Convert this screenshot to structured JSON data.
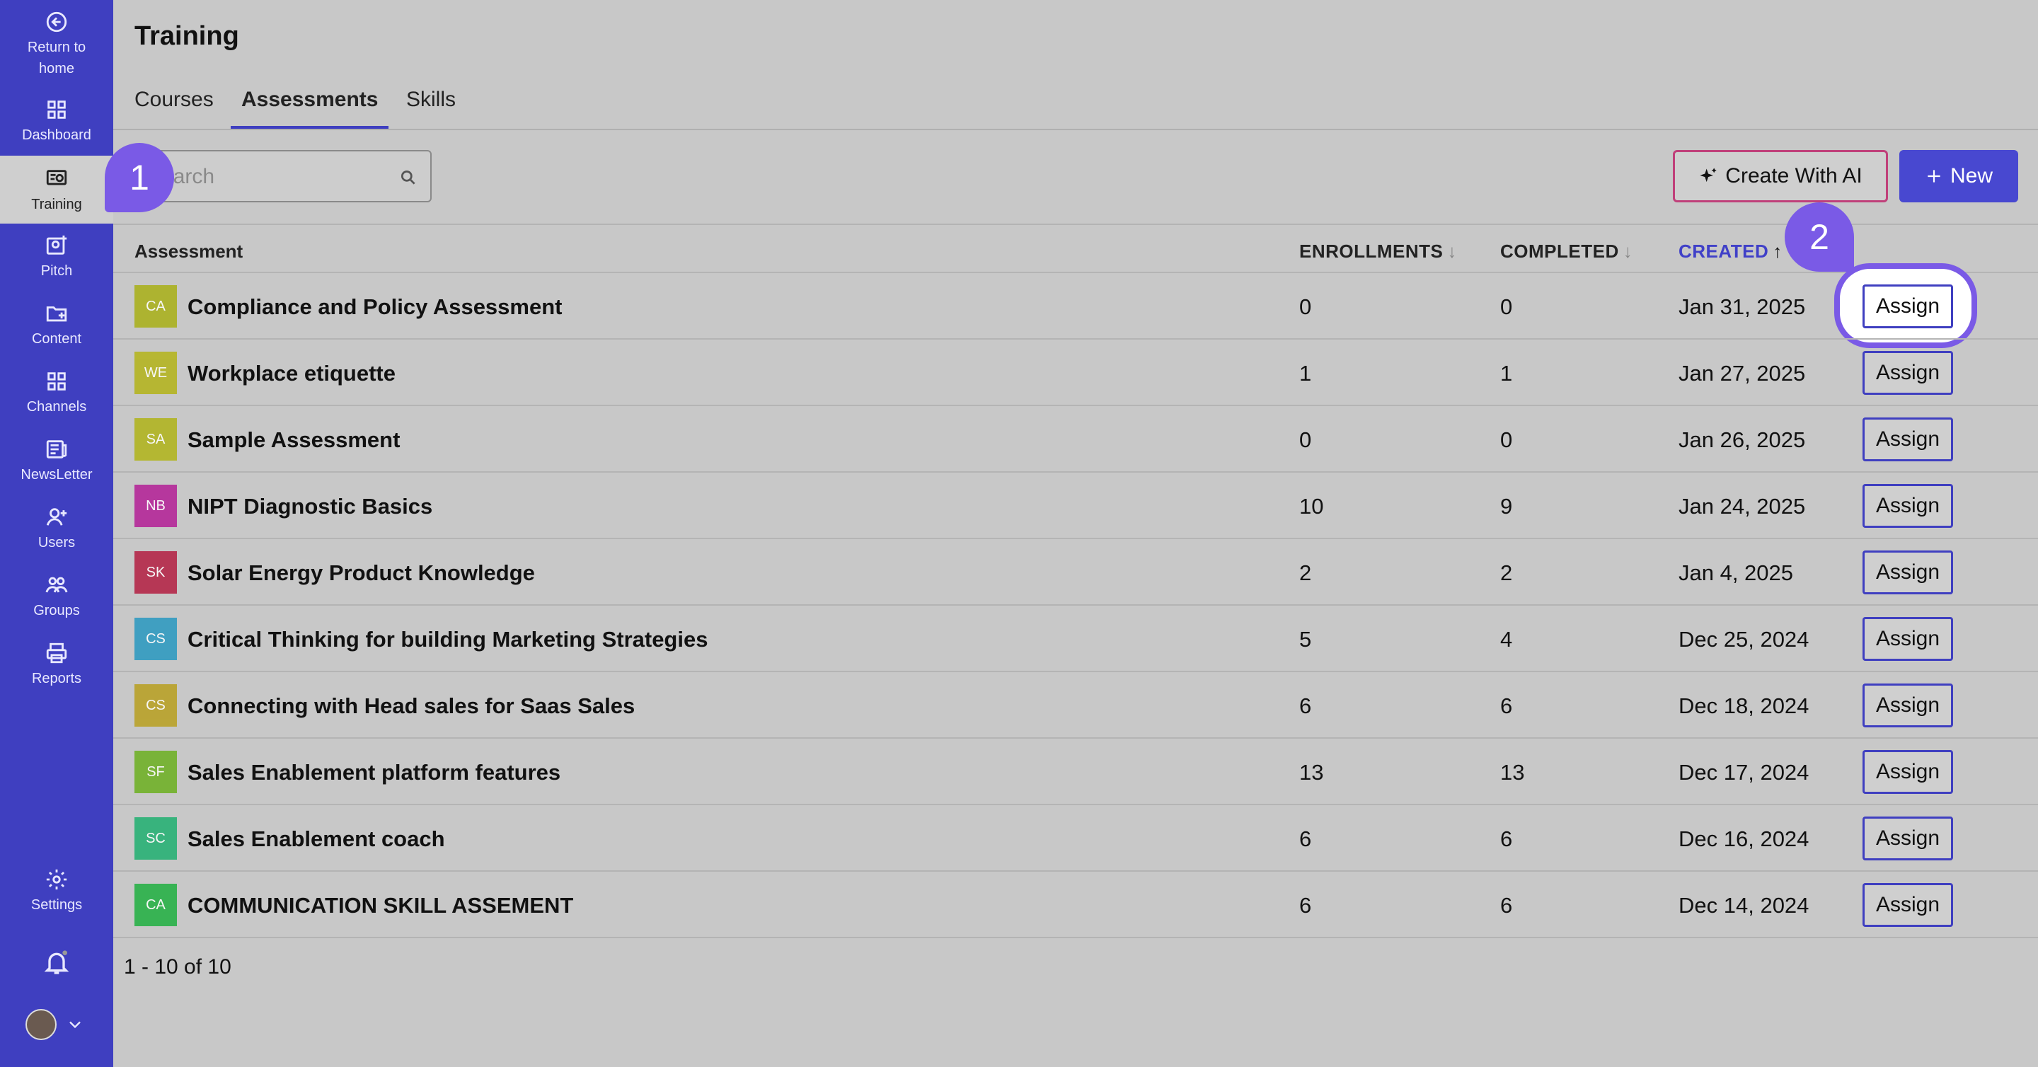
{
  "sidebar": {
    "items": [
      {
        "label": "Return to home",
        "icon": "arrow-left-circle-icon"
      },
      {
        "label": "Dashboard",
        "icon": "grid-icon"
      },
      {
        "label": "Training",
        "icon": "training-icon"
      },
      {
        "label": "Pitch",
        "icon": "pitch-icon"
      },
      {
        "label": "Content",
        "icon": "folder-plus-icon"
      },
      {
        "label": "Channels",
        "icon": "grid-icon"
      },
      {
        "label": "NewsLetter",
        "icon": "newsletter-icon"
      },
      {
        "label": "Users",
        "icon": "user-plus-icon"
      },
      {
        "label": "Groups",
        "icon": "groups-icon"
      },
      {
        "label": "Reports",
        "icon": "printer-icon"
      },
      {
        "label": "Settings",
        "icon": "gear-icon"
      }
    ]
  },
  "header": {
    "title": "Training"
  },
  "tabs": [
    {
      "label": "Courses"
    },
    {
      "label": "Assessments"
    },
    {
      "label": "Skills"
    }
  ],
  "toolbar": {
    "search_placeholder": "Search",
    "create_ai_label": "Create With AI",
    "new_label": "New"
  },
  "table": {
    "headers": {
      "assessment": "Assessment",
      "enrollments": "ENROLLMENTS",
      "completed": "COMPLETED",
      "created": "CREATED"
    },
    "assign_label": "Assign",
    "rows": [
      {
        "initials": "CA",
        "color": "#a9b016",
        "name": "Compliance and Policy Assessment",
        "enrollments": "0",
        "completed": "0",
        "created": "Jan 31, 2025"
      },
      {
        "initials": "WE",
        "color": "#b4b418",
        "name": "Workplace etiquette",
        "enrollments": "1",
        "completed": "1",
        "created": "Jan 27, 2025"
      },
      {
        "initials": "SA",
        "color": "#b0b418",
        "name": "Sample Assessment",
        "enrollments": "0",
        "completed": "0",
        "created": "Jan 26, 2025"
      },
      {
        "initials": "NB",
        "color": "#b41e96",
        "name": "NIPT Diagnostic Basics",
        "enrollments": "10",
        "completed": "9",
        "created": "Jan 24, 2025"
      },
      {
        "initials": "SK",
        "color": "#b41e42",
        "name": "Solar Energy Product Knowledge",
        "enrollments": "2",
        "completed": "2",
        "created": "Jan 4, 2025"
      },
      {
        "initials": "CS",
        "color": "#2898c0",
        "name": "Critical Thinking for building Marketing Strategies",
        "enrollments": "5",
        "completed": "4",
        "created": "Dec 25, 2024"
      },
      {
        "initials": "CS",
        "color": "#b8a020",
        "name": "Connecting with Head sales for Saas Sales",
        "enrollments": "6",
        "completed": "6",
        "created": "Dec 18, 2024"
      },
      {
        "initials": "SF",
        "color": "#6cb020",
        "name": "Sales Enablement platform features",
        "enrollments": "13",
        "completed": "13",
        "created": "Dec 17, 2024"
      },
      {
        "initials": "SC",
        "color": "#20b070",
        "name": "Sales Enablement coach",
        "enrollments": "6",
        "completed": "6",
        "created": "Dec 16, 2024"
      },
      {
        "initials": "CA",
        "color": "#20b040",
        "name": "COMMUNICATION SKILL ASSEMENT",
        "enrollments": "6",
        "completed": "6",
        "created": "Dec 14, 2024"
      }
    ]
  },
  "pagination": {
    "text": "1 - 10 of 10"
  },
  "callouts": [
    "1",
    "2"
  ]
}
